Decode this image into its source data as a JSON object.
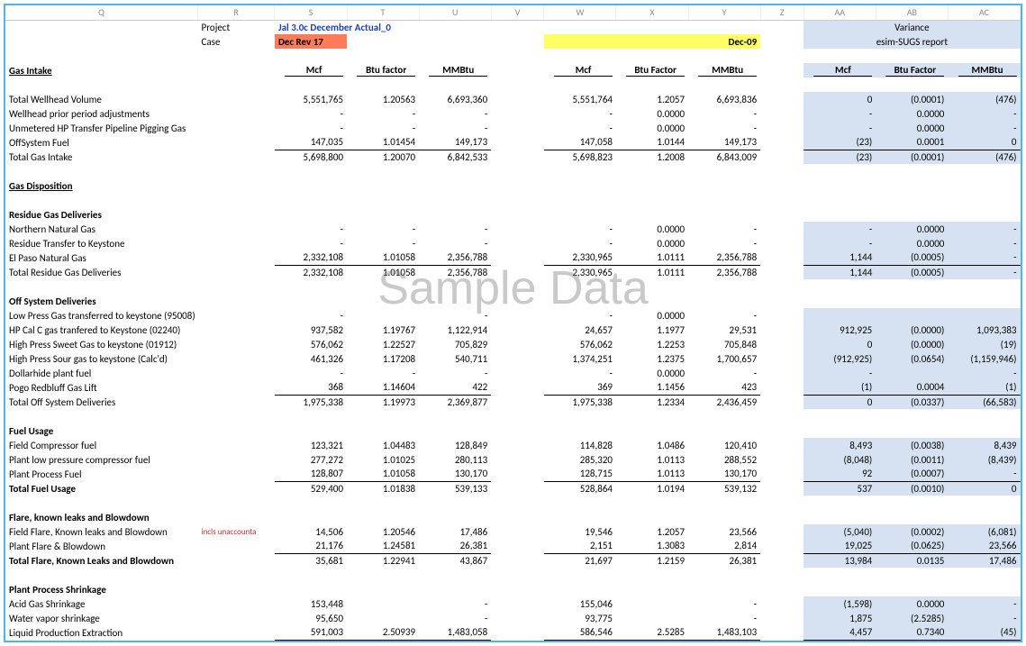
{
  "columns": [
    "Q",
    "R",
    "S",
    "T",
    "U",
    "V",
    "W",
    "X",
    "Y",
    "Z",
    "AA",
    "AB",
    "AC"
  ],
  "header": {
    "project_lbl": "Project",
    "project_val": "Jal 3.0c December Actual_0",
    "case_lbl": "Case",
    "case_val": "Dec Rev 17",
    "dec09": "Dec-09",
    "variance": "Variance",
    "esim": "esim-SUGS report"
  },
  "colhdrs": {
    "gas_intake": "Gas Intake",
    "mcf": "Mcf",
    "btu": "Btu factor",
    "mmbtu": "MMBtu",
    "mcf2": "Mcf",
    "btu2": "Btu Factor",
    "mmbtu2": "MMBtu",
    "mcf3": "Mcf",
    "btu3": "Btu Factor",
    "mmbtu3": "MMBtu"
  },
  "rows": [
    {
      "label": "Total Wellhead Volume",
      "s": "5,551,765",
      "t": "1.20563",
      "u": "6,693,360",
      "w": "5,551,764",
      "x": "1.2057",
      "y": "6,693,836",
      "aa": "0",
      "ab": "(0.0001)",
      "ac": "(476)"
    },
    {
      "label": "Wellhead prior period adjustments",
      "s": "-",
      "t": "-",
      "u": "-",
      "w": "-",
      "x": "0.0000",
      "y": "-",
      "aa": "-",
      "ab": "0.0000",
      "ac": "-"
    },
    {
      "label": "Unmetered HP Transfer Pipeline Pigging Gas",
      "s": "-",
      "t": "-",
      "u": "-",
      "w": "-",
      "x": "0.0000",
      "y": "-",
      "aa": "-",
      "ab": "0.0000",
      "ac": "-"
    },
    {
      "label": "OffSystem Fuel",
      "s": "147,035",
      "t": "1.01454",
      "u": "149,173",
      "w": "147,058",
      "x": "1.0144",
      "y": "149,173",
      "aa": "(23)",
      "ab": "0.0001",
      "ac": "0",
      "ul": true
    },
    {
      "label": "Total Gas Intake",
      "s": "5,698,800",
      "t": "1.20070",
      "u": "6,842,533",
      "w": "5,698,823",
      "x": "1.2008",
      "y": "6,843,009",
      "aa": "(23)",
      "ab": "(0.0001)",
      "ac": "(476)"
    }
  ],
  "disposition": "Gas Disposition",
  "residue_hdr": "Residue Gas Deliveries",
  "residue": [
    {
      "label": "Northern Natural Gas",
      "s": "-",
      "t": "-",
      "u": "-",
      "w": "-",
      "x": "0.0000",
      "y": "-",
      "aa": "-",
      "ab": "0.0000",
      "ac": "-"
    },
    {
      "label": "Residue Transfer to Keystone",
      "s": "-",
      "t": "-",
      "u": "-",
      "w": "-",
      "x": "0.0000",
      "y": "-",
      "aa": "-",
      "ab": "0.0000",
      "ac": "-"
    },
    {
      "label": "El Paso Natural Gas",
      "s": "2,332,108",
      "t": "1.01058",
      "u": "2,356,788",
      "w": "2,330,965",
      "x": "1.0111",
      "y": "2,356,788",
      "aa": "1,144",
      "ab": "(0.0005)",
      "ac": "-",
      "ul": true
    },
    {
      "label": "Total Residue Gas Deliveries",
      "s": "2,332,108",
      "t": "1.01058",
      "u": "2,356,788",
      "w": "2,330,965",
      "x": "1.0111",
      "y": "2,356,788",
      "aa": "1,144",
      "ab": "(0.0005)",
      "ac": "-"
    }
  ],
  "offsys_hdr": "Off System Deliveries",
  "offsys": [
    {
      "label": "Low Press Gas transferred to keystone (95008)",
      "s": "-",
      "t": "",
      "u": "-",
      "w": "-",
      "x": "0.0000",
      "y": "-",
      "aa": "",
      "ab": "",
      "ac": ""
    },
    {
      "label": "HP Cal C gas tranfered to Keystone (02240)",
      "s": "937,582",
      "t": "1.19767",
      "u": "1,122,914",
      "w": "24,657",
      "x": "1.1977",
      "y": "29,531",
      "aa": "912,925",
      "ab": "(0.0000)",
      "ac": "1,093,383"
    },
    {
      "label": "High Press Sweet Gas to keystone (01912)",
      "s": "576,062",
      "t": "1.22527",
      "u": "705,829",
      "w": "576,062",
      "x": "1.2253",
      "y": "705,848",
      "aa": "0",
      "ab": "(0.0000)",
      "ac": "(19)"
    },
    {
      "label": "High Press Sour gas to keystone (Calc'd)",
      "s": "461,326",
      "t": "1.17208",
      "u": "540,711",
      "w": "1,374,251",
      "x": "1.2375",
      "y": "1,700,657",
      "aa": "(912,925)",
      "ab": "(0.0654)",
      "ac": "(1,159,946)"
    },
    {
      "label": "Dollarhide plant fuel",
      "s": "-",
      "t": "-",
      "u": "-",
      "w": "-",
      "x": "0.0000",
      "y": "-",
      "aa": "-",
      "ab": "",
      "ac": "-"
    },
    {
      "label": "Pogo Redbluff Gas Lift",
      "s": "368",
      "t": "1.14604",
      "u": "422",
      "w": "369",
      "x": "1.1456",
      "y": "423",
      "aa": "(1)",
      "ab": "0.0004",
      "ac": "(1)",
      "ul": true
    },
    {
      "label": "Total Off System Deliveries",
      "s": "1,975,338",
      "t": "1.19973",
      "u": "2,369,877",
      "w": "1,975,338",
      "x": "1.2334",
      "y": "2,436,459",
      "aa": "0",
      "ab": "(0.0337)",
      "ac": "(66,583)"
    }
  ],
  "fuel_hdr": "Fuel Usage",
  "fuel": [
    {
      "label": "Field Compressor fuel",
      "s": "123,321",
      "t": "1.04483",
      "u": "128,849",
      "w": "114,828",
      "x": "1.0486",
      "y": "120,410",
      "aa": "8,493",
      "ab": "(0.0038)",
      "ac": "8,439"
    },
    {
      "label": "Plant low pressure compressor fuel",
      "s": "277,272",
      "t": "1.01025",
      "u": "280,113",
      "w": "285,320",
      "x": "1.0113",
      "y": "288,552",
      "aa": "(8,048)",
      "ab": "(0.0011)",
      "ac": "(8,439)"
    },
    {
      "label": "Plant Process Fuel",
      "s": "128,807",
      "t": "1.01058",
      "u": "130,170",
      "w": "128,715",
      "x": "1.0113",
      "y": "130,170",
      "aa": "92",
      "ab": "(0.0007)",
      "ac": "-",
      "ul": true
    },
    {
      "label": "Total Fuel Usage",
      "s": "529,400",
      "t": "1.01838",
      "u": "539,133",
      "w": "528,864",
      "x": "1.0194",
      "y": "539,132",
      "aa": "537",
      "ab": "(0.0010)",
      "ac": "0",
      "bold": true
    }
  ],
  "flare_hdr": "Flare, known leaks and Blowdown",
  "flare_note": "incls unaccounta",
  "flare": [
    {
      "label": "Field Flare, Known leaks and Blowdown",
      "s": "14,506",
      "t": "1.20546",
      "u": "17,486",
      "w": "19,546",
      "x": "1.2057",
      "y": "23,566",
      "aa": "(5,040)",
      "ab": "(0.0002)",
      "ac": "(6,081)"
    },
    {
      "label": "Plant Flare & Blowdown",
      "s": "21,176",
      "t": "1.24581",
      "u": "26,381",
      "w": "2,151",
      "x": "1.3083",
      "y": "2,814",
      "aa": "19,025",
      "ab": "(0.0625)",
      "ac": "23,566",
      "ul": true
    },
    {
      "label": "Total Flare, Known Leaks and Blowdown",
      "s": "35,681",
      "t": "1.22941",
      "u": "43,867",
      "w": "21,697",
      "x": "1.2159",
      "y": "26,381",
      "aa": "13,984",
      "ab": "0.0135",
      "ac": "17,486",
      "bold": true
    }
  ],
  "shrink_hdr": "Plant Process Shrinkage",
  "shrink": [
    {
      "label": "Acid Gas Shrinkage",
      "s": "153,448",
      "t": "",
      "u": "-",
      "w": "155,046",
      "x": "",
      "y": "-",
      "aa": "(1,598)",
      "ab": "0.0000",
      "ac": "-"
    },
    {
      "label": "Water vapor shrinkage",
      "s": "95,650",
      "t": "",
      "u": "-",
      "w": "93,775",
      "x": "",
      "y": "-",
      "aa": "1,875",
      "ab": "(2.5285)",
      "ac": "-"
    },
    {
      "label": "Liquid Production Extraction",
      "s": "591,003",
      "t": "2.50939",
      "u": "1,483,058",
      "w": "586,546",
      "x": "2.5285",
      "y": "1,483,103",
      "aa": "4,457",
      "ab": "0.7340",
      "ac": "(45)",
      "ul": true
    }
  ],
  "watermark": "Sample Data"
}
